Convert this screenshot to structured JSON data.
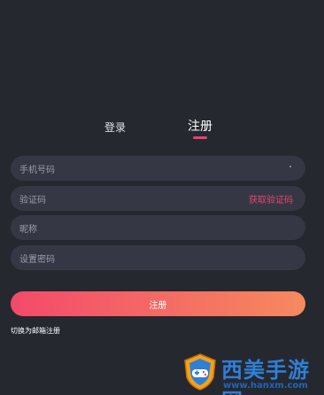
{
  "tabs": {
    "login_label": "登录",
    "register_label": "注册",
    "active": "register"
  },
  "form": {
    "phone_placeholder": "手机号码",
    "code_placeholder": "验证码",
    "get_code_label": "获取验证码",
    "nickname_placeholder": "昵称",
    "password_placeholder": "设置密码",
    "submit_label": "注册",
    "switch_label": "切换为邮箱注册"
  },
  "watermark": {
    "title": "西美手游网",
    "url": "www.hanxm.com"
  },
  "colors": {
    "background": "#262830",
    "field": "#353844",
    "accent": "#e8446c",
    "button_gradient_start": "#f34a6a",
    "button_gradient_end": "#f58a5e"
  }
}
